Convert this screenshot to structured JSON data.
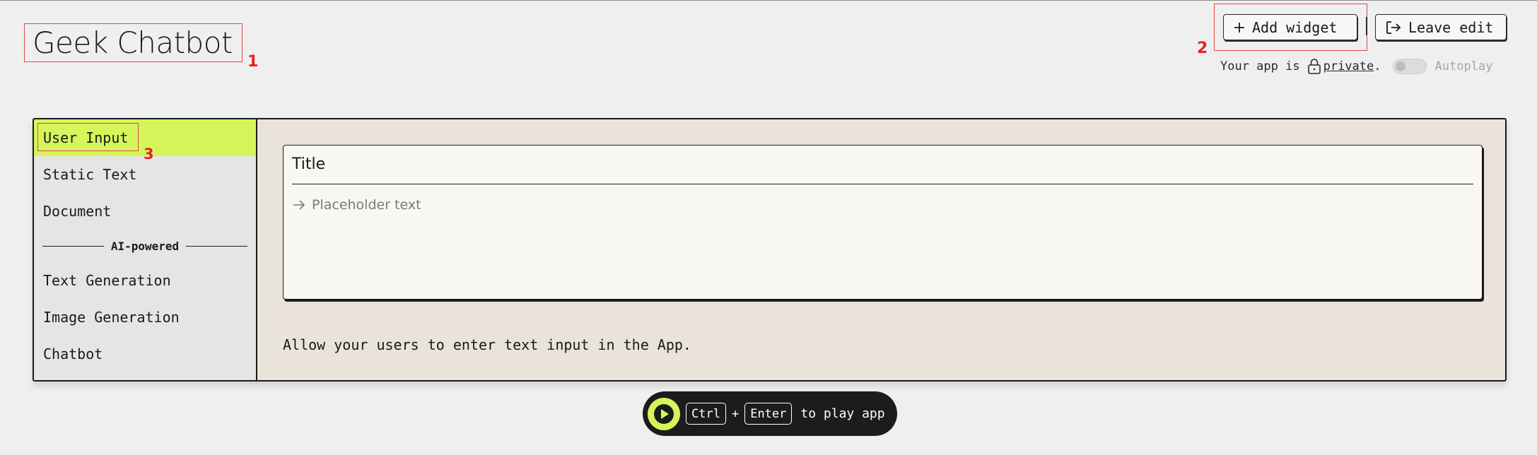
{
  "app": {
    "title": "Geek Chatbot"
  },
  "markers": {
    "m1": "1",
    "m2": "2",
    "m3": "3"
  },
  "toolbar": {
    "add_widget_label": "Add widget",
    "leave_edit_label": "Leave edit",
    "add_icon": "plus-icon",
    "leave_icon": "exit-icon"
  },
  "privacy": {
    "prefix": "Your app is",
    "link_text": "private",
    "suffix": ".",
    "lock_icon": "lock-icon",
    "autoplay_label": "Autoplay",
    "autoplay_enabled": false
  },
  "sidebar": {
    "items_top": [
      {
        "label": "User Input",
        "active": true
      },
      {
        "label": "Static Text",
        "active": false
      },
      {
        "label": "Document",
        "active": false
      }
    ],
    "section_label": "AI-powered",
    "items_ai": [
      {
        "label": "Text Generation",
        "active": false
      },
      {
        "label": "Image Generation",
        "active": false
      },
      {
        "label": "Chatbot",
        "active": false
      }
    ]
  },
  "preview": {
    "title": "Title",
    "placeholder": "Placeholder text",
    "arrow_icon": "arrow-right-icon"
  },
  "description": "Allow your users to enter text input in the App.",
  "play_bar": {
    "key1": "Ctrl",
    "plus": "+",
    "key2": "Enter",
    "text": "to play app",
    "play_icon": "play-icon"
  },
  "colors": {
    "accent": "#d6f55b",
    "background": "#efefef",
    "panel": "#e9e3d9",
    "sidebar": "#e5e5e5",
    "annotation": "#e32227"
  }
}
